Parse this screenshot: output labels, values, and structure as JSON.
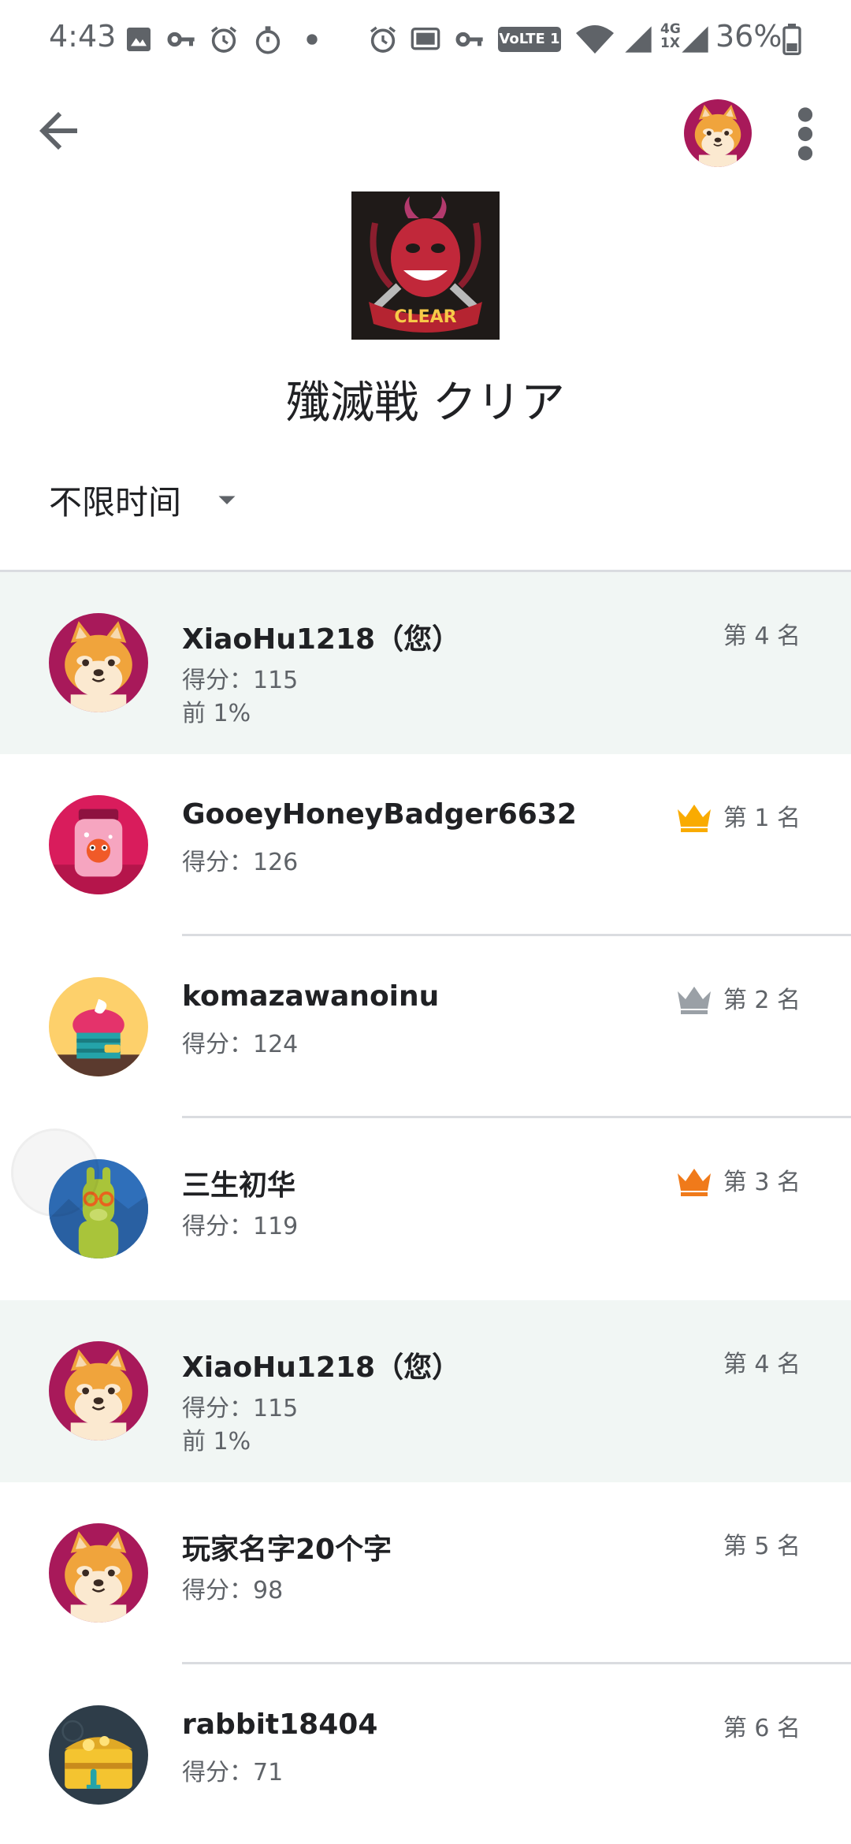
{
  "status_bar": {
    "time": "4:43",
    "network_badge": "VoLTE 1",
    "network_type_top": "4G",
    "network_type_bottom": "1X",
    "battery": "36%",
    "left_icons": [
      "image-icon",
      "key-icon",
      "alarm-icon",
      "stopwatch-icon",
      "dot-icon"
    ],
    "right_icons": [
      "alarm-icon",
      "cast-icon",
      "key-icon",
      "wifi-icon",
      "signal-icon",
      "battery-icon"
    ]
  },
  "app_bar": {
    "back_icon": "arrow-back-icon",
    "overflow_icon": "more-vert-icon"
  },
  "achievement": {
    "title": "殲滅戦 クリア",
    "badge_text": "CLEAR"
  },
  "filter": {
    "selected": "不限时间"
  },
  "leaderboard": [
    {
      "name": "XiaoHu1218（您）",
      "score": "得分：115",
      "percentile": "前 1%",
      "rank": "第 4 名",
      "crown": "",
      "avatar": "shiba",
      "highlight": true
    },
    {
      "name": "GooeyHoneyBadger6632",
      "score": "得分：126",
      "percentile": "",
      "rank": "第 1 名",
      "crown": "gold",
      "avatar": "jar",
      "highlight": false
    },
    {
      "name": "komazawanoinu",
      "score": "得分：124",
      "percentile": "",
      "rank": "第 2 名",
      "crown": "silver",
      "avatar": "cupcake",
      "highlight": false
    },
    {
      "name": "三生初华",
      "score": "得分：119",
      "percentile": "",
      "rank": "第 3 名",
      "crown": "bronze",
      "avatar": "llama",
      "highlight": false
    },
    {
      "name": "XiaoHu1218（您）",
      "score": "得分：115",
      "percentile": "前 1%",
      "rank": "第 4 名",
      "crown": "",
      "avatar": "shiba",
      "highlight": true
    },
    {
      "name": "玩家名字20个字",
      "score": "得分：98",
      "percentile": "",
      "rank": "第 5 名",
      "crown": "",
      "avatar": "shiba",
      "highlight": false
    },
    {
      "name": "rabbit18404",
      "score": "得分：71",
      "percentile": "",
      "rank": "第 6 名",
      "crown": "",
      "avatar": "treasure",
      "highlight": false
    }
  ],
  "colors": {
    "highlight_row": "#f1f6f4",
    "crown_gold": "#f9ab00",
    "crown_silver": "#9aa0a6",
    "crown_bronze": "#f07a1a",
    "divider": "#dadce0"
  }
}
